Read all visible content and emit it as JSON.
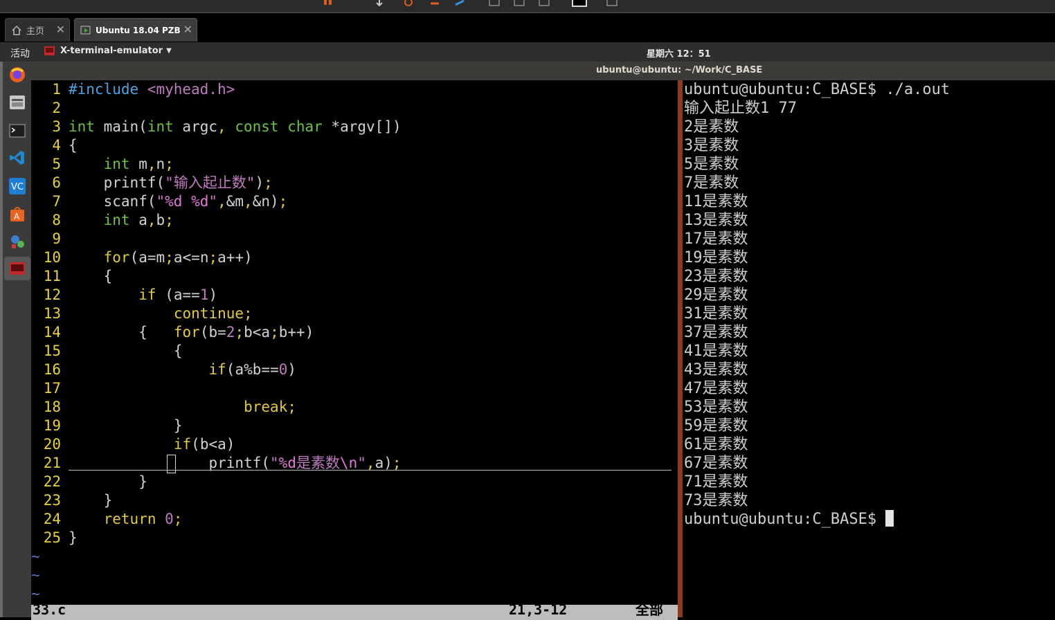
{
  "vm_tabs": [
    {
      "label": "主页",
      "icon": "home-icon"
    },
    {
      "label": "Ubuntu 18.04 PZB",
      "icon": "vm-icon"
    }
  ],
  "topbar": {
    "activities": "活动",
    "app_name": "X-terminal-emulator",
    "clock": "星期六 12：51"
  },
  "window_title": "ubuntu@ubuntu: ~/Work/C_BASE",
  "dock": [
    "firefox-icon",
    "files-icon",
    "terminal-icon",
    "vscode-icon",
    "vc-icon",
    "software-center-icon",
    "system-settings-icon",
    "x-terminal-icon"
  ],
  "editor": {
    "lines": [
      "#include <myhead.h>",
      "",
      "int main(int argc, const char *argv[])",
      "{",
      "    int m,n;",
      "    printf(\"输入起止数\");",
      "    scanf(\"%d %d\",&m,&n);",
      "    int a,b;",
      "",
      "    for(a=m;a<=n;a++)",
      "    {",
      "        if (a==1)",
      "            continue;",
      "        {   for(b=2;b<a;b++)",
      "            {",
      "                if(a%b==0)",
      "",
      "                    break;",
      "            }",
      "            if(b<a)",
      "                printf(\"%d是素数\\n\",a);",
      "        }",
      "    }",
      "    return 0;",
      "}"
    ],
    "tildes": [
      "~",
      "~",
      "~"
    ],
    "status_file": "33.c",
    "status_pos": "21,3-12",
    "status_all": "全部"
  },
  "terminal": {
    "lines": [
      "ubuntu@ubuntu:C_BASE$ ./a.out",
      "输入起止数1 77",
      "2是素数",
      "3是素数",
      "5是素数",
      "7是素数",
      "11是素数",
      "13是素数",
      "17是素数",
      "19是素数",
      "23是素数",
      "29是素数",
      "31是素数",
      "37是素数",
      "41是素数",
      "43是素数",
      "47是素数",
      "53是素数",
      "59是素数",
      "61是素数",
      "67是素数",
      "71是素数",
      "73是素数"
    ],
    "prompt": "ubuntu@ubuntu:C_BASE$ "
  }
}
